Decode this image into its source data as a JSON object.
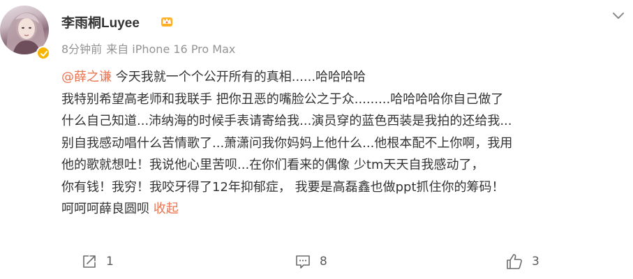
{
  "post": {
    "author": {
      "name": "李雨桐Luyee",
      "avatar_icon": "user-avatar-photo",
      "verified_icon": "verified-badge-icon",
      "member_icon": "crown-icon"
    },
    "time": "8分钟前",
    "source": "来自 iPhone 16 Pro Max",
    "menu_icon": "chevron-down-icon",
    "content": {
      "mention": "@薛之谦",
      "line1_rest": " 今天我就一个个公开所有的真相......哈哈哈哈",
      "line2": "我特别希望高老师和我联手 把你丑恶的嘴脸公之于众.........哈哈哈哈你自己做了",
      "line3": "什么自己知道...沛纳海的时候手表请寄给我...演员穿的蓝色西装是我拍的还给我...",
      "line4": "别自我感动唱什么苦情歌了...萧潇问我你妈妈上他什么...他根本配不上你啊，我用",
      "line5": "他的歌就想吐！我说他心里苦呗...在你们看来的偶像 少tm天天自我感动了，",
      "line6": "你有钱！我穷！我咬牙得了12年抑郁症， 我要是高磊鑫也做ppt抓住你的筹码！",
      "line7": "呵呵呵薛良圆呗 ",
      "collapse_label": "收起"
    },
    "actions": {
      "share": {
        "icon": "share-icon",
        "count": "1"
      },
      "comment": {
        "icon": "comment-icon",
        "count": "8"
      },
      "like": {
        "icon": "like-icon",
        "count": "3"
      }
    },
    "colors": {
      "link": "#eb7350",
      "text": "#333333",
      "meta": "#939393",
      "badge": "#f7b500"
    }
  }
}
